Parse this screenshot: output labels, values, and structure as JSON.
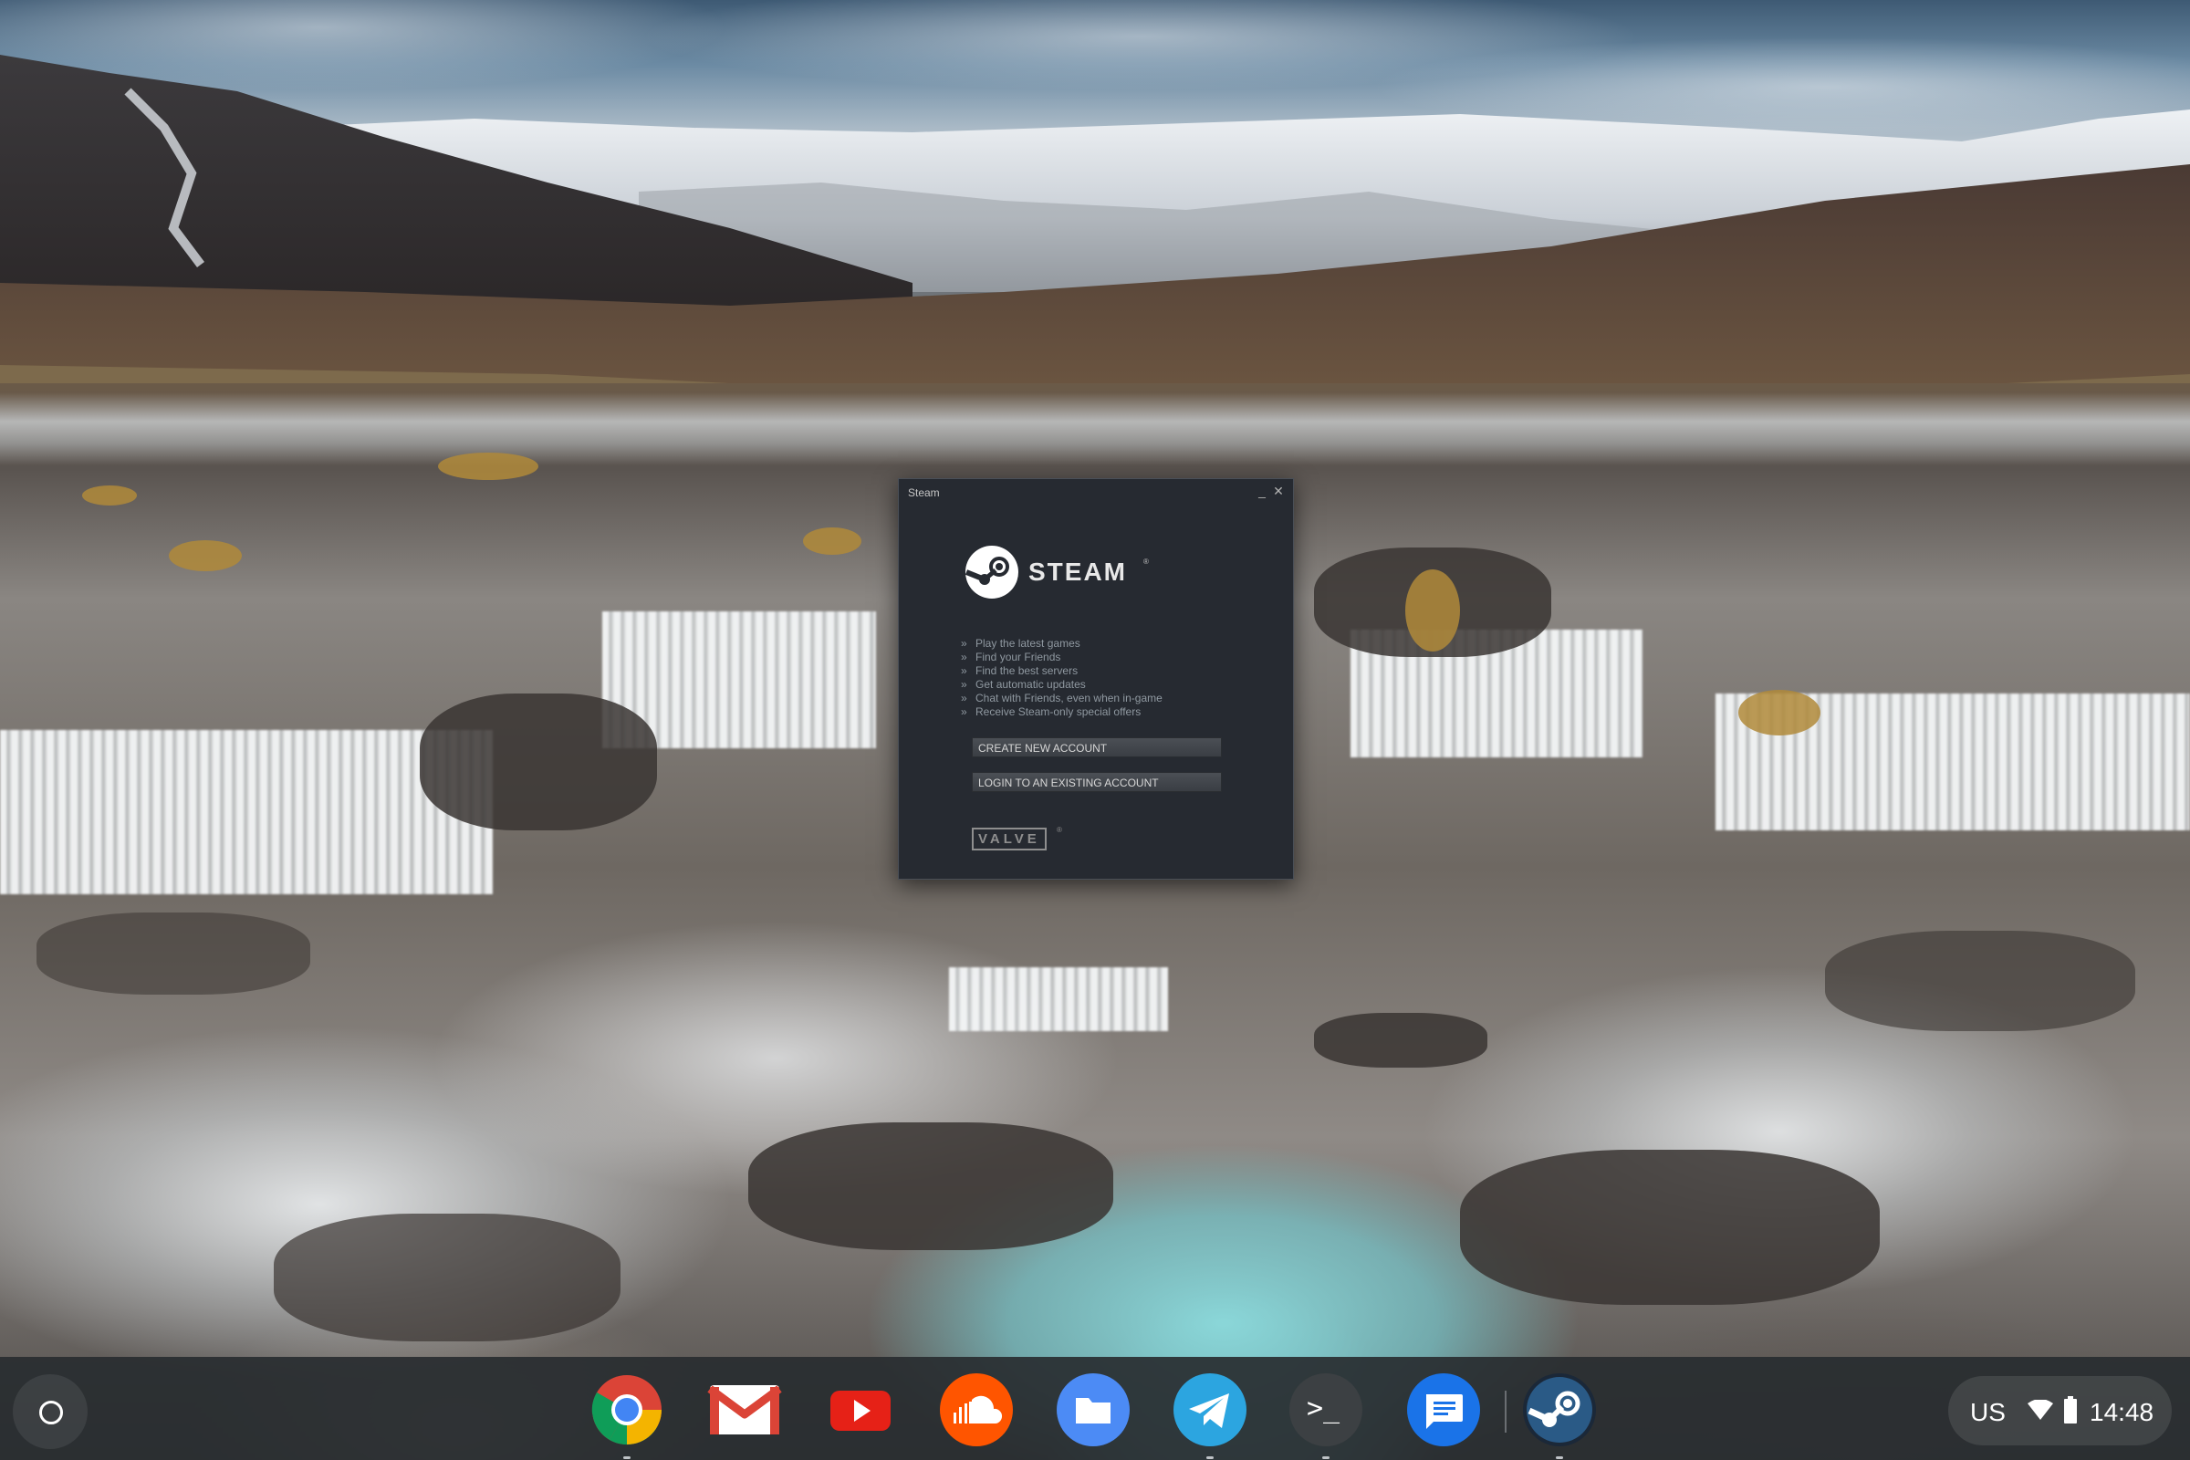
{
  "steam_window": {
    "title": "Steam",
    "minimize_glyph": "_",
    "close_glyph": "✕",
    "logo_text": "STEAM",
    "logo_mark": "®",
    "features": [
      "Play the latest games",
      "Find your Friends",
      "Find the best servers",
      "Get automatic updates",
      "Chat with Friends, even when in-game",
      "Receive Steam-only special offers"
    ],
    "create_account_label": "CREATE NEW ACCOUNT",
    "login_label": "LOGIN TO AN EXISTING ACCOUNT",
    "valve_logo": "VALVE",
    "valve_mark": "®"
  },
  "shelf": {
    "apps": [
      {
        "icon": "chrome-icon"
      },
      {
        "icon": "gmail-icon"
      },
      {
        "icon": "youtube-icon"
      },
      {
        "icon": "soundcloud-icon"
      },
      {
        "icon": "files-icon"
      },
      {
        "icon": "telegram-icon"
      },
      {
        "icon": "terminal-icon",
        "glyph": ">_"
      },
      {
        "icon": "messages-icon"
      },
      {
        "icon": "steam-icon"
      }
    ],
    "tray": {
      "ime": "US",
      "time": "14:48"
    }
  },
  "colors": {
    "steam_bg": "#262a31",
    "steam_button": "#3f434a",
    "shelf_bg": "#282c30",
    "chrome_red": "#db4437",
    "chrome_yellow": "#f4b400",
    "chrome_green": "#0f9d58",
    "chrome_blue": "#4285f4",
    "youtube_red": "#e62117",
    "soundcloud_orange": "#ff5500",
    "files_blue": "#4c8bf5",
    "telegram_blue": "#2ca5e0"
  }
}
